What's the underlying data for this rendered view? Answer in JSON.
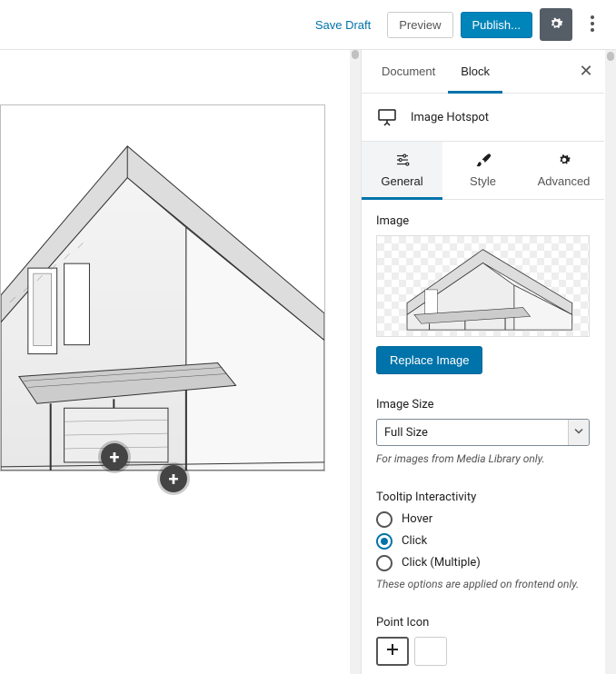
{
  "topbar": {
    "save_draft": "Save Draft",
    "preview": "Preview",
    "publish": "Publish..."
  },
  "canvas": {
    "hotspots": [
      {
        "glyph": "+"
      },
      {
        "glyph": "+"
      }
    ]
  },
  "sidebar": {
    "tabs": {
      "document": "Document",
      "block": "Block"
    },
    "block_name": "Image Hotspot",
    "subtabs": {
      "general": "General",
      "style": "Style",
      "advanced": "Advanced"
    },
    "image": {
      "label": "Image",
      "replace_btn": "Replace Image"
    },
    "image_size": {
      "label": "Image Size",
      "value": "Full Size",
      "hint": "For images from Media Library only."
    },
    "tooltip": {
      "label": "Tooltip Interactivity",
      "options": {
        "hover": "Hover",
        "click": "Click",
        "click_multiple": "Click (Multiple)"
      },
      "selected": "click",
      "hint": "These options are applied on frontend only."
    },
    "point_icon": {
      "label": "Point Icon"
    }
  }
}
